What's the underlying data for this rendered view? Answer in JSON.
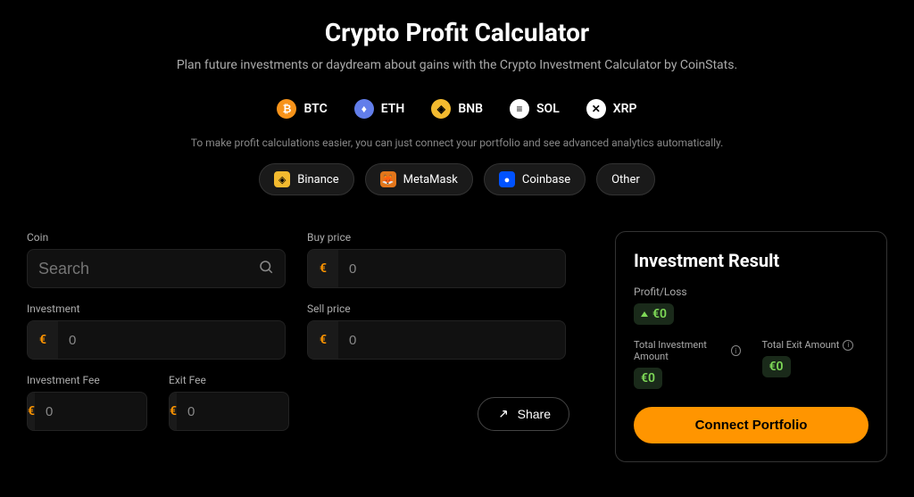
{
  "title": "Crypto Profit Calculator",
  "subtitle": "Plan future investments or daydream about gains with the Crypto Investment Calculator by CoinStats.",
  "coins": [
    {
      "symbol": "BTC",
      "bg": "#f7931a",
      "fg": "#fff",
      "char": "₿"
    },
    {
      "symbol": "ETH",
      "bg": "#627eea",
      "fg": "#fff",
      "char": "♦"
    },
    {
      "symbol": "BNB",
      "bg": "#f3ba2f",
      "fg": "#000",
      "char": "◈"
    },
    {
      "symbol": "SOL",
      "bg": "#fff",
      "fg": "#000",
      "char": "≡"
    },
    {
      "symbol": "XRP",
      "bg": "#fff",
      "fg": "#000",
      "char": "✕"
    }
  ],
  "hint": "To make profit calculations easier, you can just connect your portfolio and see advanced analytics automatically.",
  "wallets": [
    {
      "name": "Binance",
      "bg": "#f3ba2f",
      "fg": "#000",
      "char": "◈"
    },
    {
      "name": "MetaMask",
      "bg": "#e2761b",
      "fg": "#fff",
      "char": "🦊"
    },
    {
      "name": "Coinbase",
      "bg": "#0052ff",
      "fg": "#fff",
      "char": "●"
    },
    {
      "name": "Other",
      "bg": "",
      "fg": "",
      "char": ""
    }
  ],
  "fields": {
    "coin": {
      "label": "Coin",
      "placeholder": "Search"
    },
    "buy_price": {
      "label": "Buy price",
      "value": "0"
    },
    "investment": {
      "label": "Investment",
      "value": "0"
    },
    "sell_price": {
      "label": "Sell price",
      "value": "0"
    },
    "investment_fee": {
      "label": "Investment Fee",
      "value": "0"
    },
    "exit_fee": {
      "label": "Exit Fee",
      "value": "0"
    }
  },
  "currency_symbol": "€",
  "share_label": "Share",
  "result": {
    "title": "Investment Result",
    "profit_loss_label": "Profit/Loss",
    "profit_loss_value": "€0",
    "total_investment_label": "Total Investment Amount",
    "total_investment_value": "€0",
    "total_exit_label": "Total Exit Amount",
    "total_exit_value": "€0",
    "connect_label": "Connect Portfolio"
  }
}
